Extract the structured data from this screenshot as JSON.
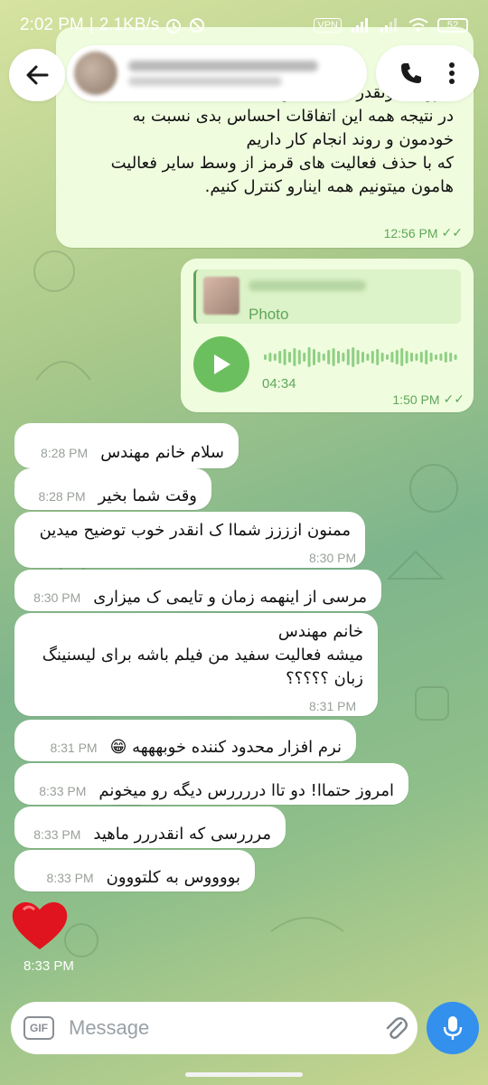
{
  "status_bar": {
    "time": "2:02 PM",
    "speed": "2.1KB/s",
    "vpn": "VPN",
    "battery": "52"
  },
  "header": {
    "back_icon": "arrow-left-icon",
    "call_icon": "phone-icon",
    "menu_icon": "more-vertical-icon"
  },
  "messages_out": [
    {
      "lines": [
        "خروجی اونقدر که باید خوب نیست.",
        "در نتیجه همه این اتفاقات احساس بدی نسبت به",
        "خودمون و روند انجام کار داریم",
        "که با حذف فعالیت های قرمز از وسط سایر فعالیت",
        "هامون میتونیم همه اینارو کنترل کنیم."
      ],
      "time": "12:56 PM",
      "ticks": "✓✓"
    },
    {
      "reply_label": "Photo",
      "duration": "04:34",
      "time": "1:50 PM",
      "ticks": "✓✓"
    }
  ],
  "messages_in": [
    {
      "text": "سلام خانم مهندس",
      "time": "8:28 PM"
    },
    {
      "text": "وقت شما بخیر",
      "time": "8:28 PM"
    },
    {
      "text": "ممنون ازززز شماا ک انقدر خوب  توضیح میدین",
      "time": "8:30 PM"
    },
    {
      "text": "مرسی از اینهمه زمان و تایمی ک میزاری",
      "time": "8:30 PM"
    },
    {
      "lines": [
        "خانم مهندس",
        "میشه فعالیت سفید من فیلم باشه برای لیسنینگ",
        "زبان ؟؟؟؟؟"
      ],
      "time": "8:31 PM"
    },
    {
      "text": "نرم افزار محدود کننده خوبهههه 😁",
      "time": "8:31 PM"
    },
    {
      "text": "امروز حتماا! دو تاا دررررس دیگه رو میخونم",
      "time": "8:33 PM"
    },
    {
      "text": "مرررسی که انقدررر ماهید",
      "time": "8:33 PM"
    },
    {
      "text": "بووووس به کلتووون",
      "time": "8:33 PM"
    }
  ],
  "heart_message": {
    "time": "8:33 PM"
  },
  "input": {
    "gif_label": "GIF",
    "placeholder": "Message"
  },
  "colors": {
    "outgoing_bubble": "#effdde",
    "accent_green": "#5fa65a",
    "send_blue": "#3390ec"
  }
}
